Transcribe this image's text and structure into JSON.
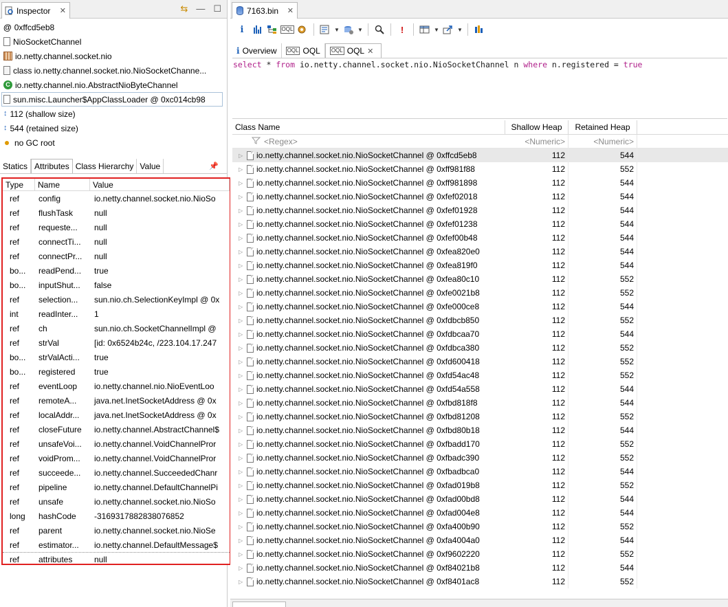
{
  "inspector": {
    "title": "Inspector",
    "rows": [
      {
        "icon": "address-icon",
        "text": "0xffcd5eb8"
      },
      {
        "icon": "class-file-icon",
        "text": "NioSocketChannel"
      },
      {
        "icon": "package-icon",
        "text": "io.netty.channel.socket.nio"
      },
      {
        "icon": "class-object-icon",
        "text": "class io.netty.channel.socket.nio.NioSocketChanne..."
      },
      {
        "icon": "superclass-icon",
        "text": "io.netty.channel.nio.AbstractNioByteChannel"
      },
      {
        "icon": "classloader-icon",
        "text": "sun.misc.Launcher$AppClassLoader @ 0xc014cb98"
      },
      {
        "icon": "shallow-size-icon",
        "text": "112 (shallow size)"
      },
      {
        "icon": "retained-size-icon",
        "text": "544 (retained size)"
      },
      {
        "icon": "gc-root-icon",
        "text": "no GC root"
      }
    ],
    "sub_tabs": [
      "Statics",
      "Attributes",
      "Class Hierarchy",
      "Value"
    ],
    "active_sub_tab": "Attributes",
    "attributes": {
      "headers": [
        "Type",
        "Name",
        "Value"
      ],
      "rows": [
        [
          "ref",
          "config",
          "io.netty.channel.socket.nio.NioSo"
        ],
        [
          "ref",
          "flushTask",
          "null"
        ],
        [
          "ref",
          "requeste...",
          "null"
        ],
        [
          "ref",
          "connectTi...",
          "null"
        ],
        [
          "ref",
          "connectPr...",
          "null"
        ],
        [
          "bo...",
          "readPend...",
          "true"
        ],
        [
          "bo...",
          "inputShut...",
          "false"
        ],
        [
          "ref",
          "selection...",
          "sun.nio.ch.SelectionKeyImpl @ 0x"
        ],
        [
          "int",
          "readInter...",
          "1"
        ],
        [
          "ref",
          "ch",
          "sun.nio.ch.SocketChannelImpl @"
        ],
        [
          "ref",
          "strVal",
          "[id: 0x6524b24c, /223.104.17.247"
        ],
        [
          "bo...",
          "strValActi...",
          "true"
        ],
        [
          "bo...",
          "registered",
          "true"
        ],
        [
          "ref",
          "eventLoop",
          "io.netty.channel.nio.NioEventLoo"
        ],
        [
          "ref",
          "remoteA...",
          "java.net.InetSocketAddress @ 0x"
        ],
        [
          "ref",
          "localAddr...",
          "java.net.InetSocketAddress @ 0x"
        ],
        [
          "ref",
          "closeFuture",
          "io.netty.channel.AbstractChannel$"
        ],
        [
          "ref",
          "unsafeVoi...",
          "io.netty.channel.VoidChannelPror"
        ],
        [
          "ref",
          "voidProm...",
          "io.netty.channel.VoidChannelPror"
        ],
        [
          "ref",
          "succeede...",
          "io.netty.channel.SucceededChanr"
        ],
        [
          "ref",
          "pipeline",
          "io.netty.channel.DefaultChannelPi"
        ],
        [
          "ref",
          "unsafe",
          "io.netty.channel.socket.nio.NioSo"
        ],
        [
          "long",
          "hashCode",
          "-3169317882838076852"
        ],
        [
          "ref",
          "parent",
          "io.netty.channel.socket.nio.NioSe"
        ],
        [
          "ref",
          "estimator...",
          "io.netty.channel.DefaultMessage$"
        ],
        [
          "ref",
          "attributes",
          "null"
        ]
      ]
    }
  },
  "editor": {
    "tab_title": "7163.bin",
    "inner_tabs": [
      {
        "label": "Overview",
        "icon": "info-icon"
      },
      {
        "label": "OQL",
        "icon": "oql-icon"
      },
      {
        "label": "OQL",
        "icon": "oql-icon"
      }
    ],
    "active_inner_tab": 2,
    "query": {
      "kw_select": "select",
      "star": " * ",
      "kw_from": "from",
      "cls": " io.netty.channel.socket.nio.NioSocketChannel n ",
      "kw_where": "where",
      "cond": " n.registered = ",
      "kw_true": "true"
    },
    "results": {
      "headers": [
        "Class Name",
        "Shallow Heap",
        "Retained Heap"
      ],
      "filter": {
        "name": "<Regex>",
        "shallow": "<Numeric>",
        "retained": "<Numeric>"
      },
      "rows": [
        [
          "io.netty.channel.socket.nio.NioSocketChannel @ 0xffcd5eb8",
          "112",
          "544"
        ],
        [
          "io.netty.channel.socket.nio.NioSocketChannel @ 0xff981f88",
          "112",
          "552"
        ],
        [
          "io.netty.channel.socket.nio.NioSocketChannel @ 0xff981898",
          "112",
          "544"
        ],
        [
          "io.netty.channel.socket.nio.NioSocketChannel @ 0xfef02018",
          "112",
          "544"
        ],
        [
          "io.netty.channel.socket.nio.NioSocketChannel @ 0xfef01928",
          "112",
          "544"
        ],
        [
          "io.netty.channel.socket.nio.NioSocketChannel @ 0xfef01238",
          "112",
          "544"
        ],
        [
          "io.netty.channel.socket.nio.NioSocketChannel @ 0xfef00b48",
          "112",
          "544"
        ],
        [
          "io.netty.channel.socket.nio.NioSocketChannel @ 0xfea820e0",
          "112",
          "544"
        ],
        [
          "io.netty.channel.socket.nio.NioSocketChannel @ 0xfea819f0",
          "112",
          "544"
        ],
        [
          "io.netty.channel.socket.nio.NioSocketChannel @ 0xfea80c10",
          "112",
          "552"
        ],
        [
          "io.netty.channel.socket.nio.NioSocketChannel @ 0xfe0021b8",
          "112",
          "552"
        ],
        [
          "io.netty.channel.socket.nio.NioSocketChannel @ 0xfe000ce8",
          "112",
          "544"
        ],
        [
          "io.netty.channel.socket.nio.NioSocketChannel @ 0xfdbcb850",
          "112",
          "552"
        ],
        [
          "io.netty.channel.socket.nio.NioSocketChannel @ 0xfdbcaa70",
          "112",
          "544"
        ],
        [
          "io.netty.channel.socket.nio.NioSocketChannel @ 0xfdbca380",
          "112",
          "552"
        ],
        [
          "io.netty.channel.socket.nio.NioSocketChannel @ 0xfd600418",
          "112",
          "552"
        ],
        [
          "io.netty.channel.socket.nio.NioSocketChannel @ 0xfd54ac48",
          "112",
          "552"
        ],
        [
          "io.netty.channel.socket.nio.NioSocketChannel @ 0xfd54a558",
          "112",
          "544"
        ],
        [
          "io.netty.channel.socket.nio.NioSocketChannel @ 0xfbd818f8",
          "112",
          "544"
        ],
        [
          "io.netty.channel.socket.nio.NioSocketChannel @ 0xfbd81208",
          "112",
          "552"
        ],
        [
          "io.netty.channel.socket.nio.NioSocketChannel @ 0xfbd80b18",
          "112",
          "544"
        ],
        [
          "io.netty.channel.socket.nio.NioSocketChannel @ 0xfbadd170",
          "112",
          "552"
        ],
        [
          "io.netty.channel.socket.nio.NioSocketChannel @ 0xfbadc390",
          "112",
          "552"
        ],
        [
          "io.netty.channel.socket.nio.NioSocketChannel @ 0xfbadbca0",
          "112",
          "544"
        ],
        [
          "io.netty.channel.socket.nio.NioSocketChannel @ 0xfad019b8",
          "112",
          "552"
        ],
        [
          "io.netty.channel.socket.nio.NioSocketChannel @ 0xfad00bd8",
          "112",
          "544"
        ],
        [
          "io.netty.channel.socket.nio.NioSocketChannel @ 0xfad004e8",
          "112",
          "544"
        ],
        [
          "io.netty.channel.socket.nio.NioSocketChannel @ 0xfa400b90",
          "112",
          "552"
        ],
        [
          "io.netty.channel.socket.nio.NioSocketChannel @ 0xfa4004a0",
          "112",
          "544"
        ],
        [
          "io.netty.channel.socket.nio.NioSocketChannel @ 0xf9602220",
          "112",
          "552"
        ],
        [
          "io.netty.channel.socket.nio.NioSocketChannel @ 0xf84021b8",
          "112",
          "544"
        ],
        [
          "io.netty.channel.socket.nio.NioSocketChannel @ 0xf8401ac8",
          "112",
          "552"
        ]
      ]
    }
  },
  "colors": {
    "highlight_border": "#e02020",
    "keyword": "#b0208a",
    "accent_blue": "#1b5fb8"
  }
}
